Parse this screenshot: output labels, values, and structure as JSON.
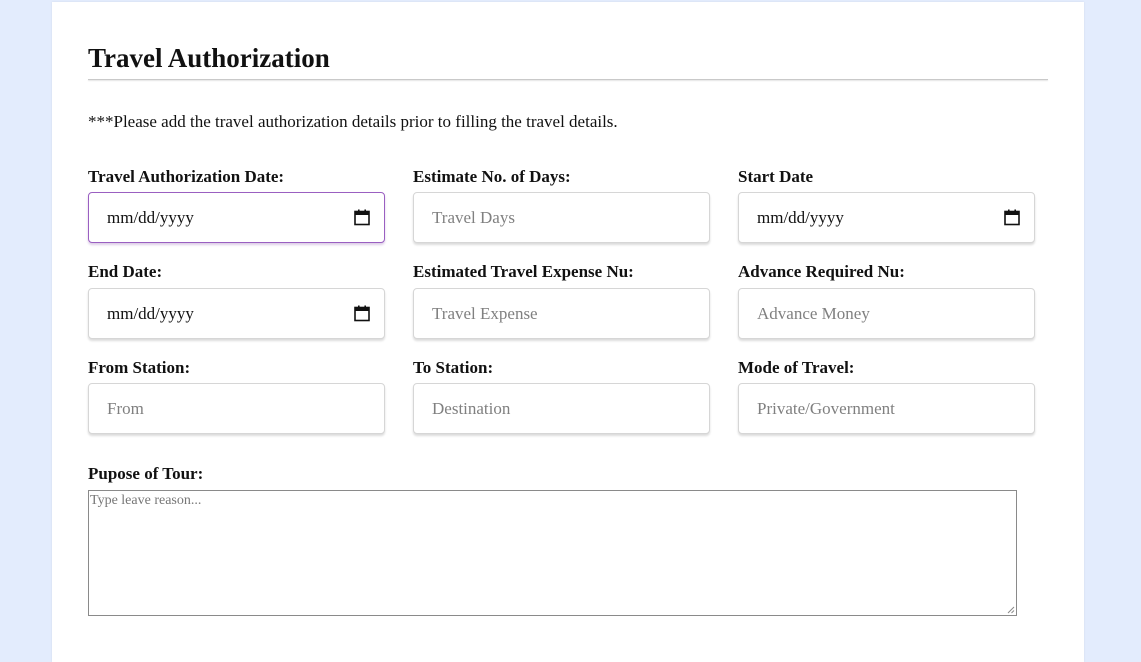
{
  "form": {
    "title": "Travel Authorization",
    "note": "***Please add the travel authorization details prior to filling the travel details.",
    "fields": {
      "auth_date": {
        "label": "Travel Authorization Date:",
        "value": "mm/dd/yyyy"
      },
      "est_days": {
        "label": "Estimate No. of Days:",
        "placeholder": "Travel Days"
      },
      "start_date": {
        "label": "Start Date",
        "value": "mm/dd/yyyy"
      },
      "end_date": {
        "label": "End Date:",
        "value": "mm/dd/yyyy"
      },
      "expense": {
        "label": "Estimated Travel Expense Nu:",
        "placeholder": "Travel Expense"
      },
      "advance": {
        "label": "Advance Required Nu:",
        "placeholder": "Advance Money"
      },
      "from_station": {
        "label": "From Station:",
        "placeholder": "From"
      },
      "to_station": {
        "label": "To Station:",
        "placeholder": "Destination"
      },
      "mode": {
        "label": "Mode of Travel:",
        "placeholder": "Private/Government"
      }
    },
    "purpose": {
      "label": "Pupose of Tour:",
      "placeholder": "Type leave reason..."
    }
  },
  "colors": {
    "page_background": "#e3ecfd",
    "card_background": "#ffffff",
    "focus_border": "#9a5fc1"
  },
  "icons": {
    "date_picker": "calendar-icon"
  }
}
